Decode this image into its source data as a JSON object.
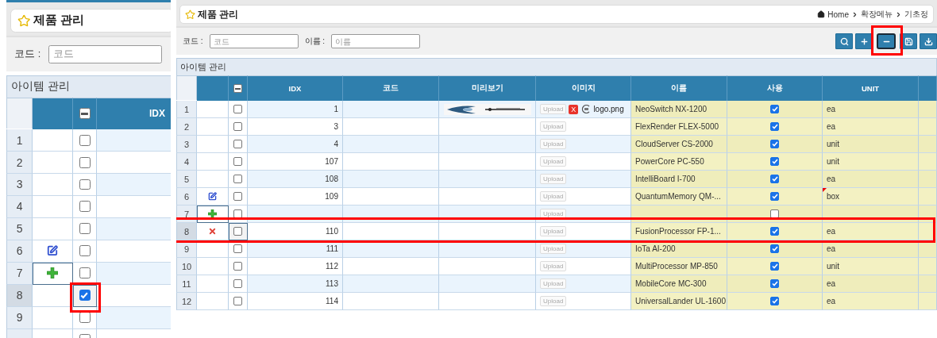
{
  "left_view": {
    "title": "제품 관리",
    "search_fields": [
      {
        "label": "코드 :",
        "placeholder": "코드"
      }
    ],
    "section_title": "아이템 관리",
    "header_partial": true,
    "columns": [
      {
        "kind": "idx",
        "label": "IDX"
      }
    ],
    "rows": [
      {
        "kind": "plain",
        "num": "1",
        "checked": false,
        "status_focused": false,
        "check_focused": false,
        "selected": false,
        "highlighted": false
      },
      {
        "kind": "plain",
        "num": "2",
        "checked": false,
        "status_focused": false,
        "check_focused": false,
        "selected": false,
        "highlighted": false
      },
      {
        "kind": "plain",
        "num": "3",
        "checked": false,
        "status_focused": false,
        "check_focused": false,
        "selected": false,
        "highlighted": false
      },
      {
        "kind": "plain",
        "num": "4",
        "checked": false,
        "status_focused": false,
        "check_focused": false,
        "selected": false,
        "highlighted": false
      },
      {
        "kind": "plain",
        "num": "5",
        "checked": false,
        "status_focused": false,
        "check_focused": false,
        "selected": false,
        "highlighted": false
      },
      {
        "kind": "edit",
        "num": "6",
        "checked": false,
        "status_focused": false,
        "check_focused": false,
        "selected": false,
        "highlighted": false
      },
      {
        "kind": "add",
        "num": "7",
        "checked": false,
        "status_focused": true,
        "check_focused": false,
        "selected": false,
        "highlighted": false
      },
      {
        "kind": "plain",
        "num": "8",
        "checked": true,
        "status_focused": false,
        "check_focused": true,
        "selected": true,
        "highlighted": true
      },
      {
        "kind": "plain",
        "num": "9",
        "checked": false,
        "status_focused": false,
        "check_focused": false,
        "selected": false,
        "highlighted": false
      },
      {
        "kind": "plain",
        "checked": false,
        "status_focused": false,
        "check_focused": false,
        "selected": false,
        "highlighted": false
      }
    ]
  },
  "right_view": {
    "title": "제품 관리",
    "breadcrumb": [
      "Home",
      "확장메뉴",
      "기초정"
    ],
    "search_fields": [
      {
        "label": "코드 :",
        "placeholder": "코드"
      },
      {
        "label": "이름 :",
        "placeholder": "이름"
      }
    ],
    "toolbar": [
      {
        "kind": "search",
        "highlighted": false
      },
      {
        "kind": "add",
        "highlighted": false
      },
      {
        "kind": "remove",
        "highlighted": true
      },
      {
        "kind": "save",
        "highlighted": false
      },
      {
        "kind": "download",
        "highlighted": false
      }
    ],
    "section_title": "아이템 관리",
    "header_partial": true,
    "columns": [
      {
        "kind": "idx",
        "label": "IDX"
      },
      {
        "kind": "code",
        "label": "코드"
      },
      {
        "kind": "preview",
        "label": "미리보기"
      },
      {
        "label": "이미지"
      },
      {
        "kind": "name",
        "label": "이름"
      },
      {
        "kind": "use",
        "label": "사용"
      },
      {
        "kind": "unit",
        "label": "UNIT"
      }
    ],
    "rows": [
      {
        "kind": "plain",
        "num": "1",
        "checked": false,
        "status_focused": false,
        "check_focused": false,
        "selected": false,
        "highlighted": false,
        "idx": "1",
        "has_preview": true,
        "upload": "Upload",
        "remove": "X",
        "file_name": "logo.png",
        "name": "NeoSwitch NX-1200",
        "use": true,
        "unit": "ea",
        "unit_flag": false
      },
      {
        "kind": "plain",
        "num": "2",
        "checked": false,
        "status_focused": false,
        "check_focused": false,
        "selected": false,
        "highlighted": false,
        "idx": "3",
        "has_preview": false,
        "upload": "Upload",
        "name": "FlexRender FLEX-5000",
        "use": true,
        "unit": "ea",
        "unit_flag": false
      },
      {
        "kind": "plain",
        "num": "3",
        "checked": false,
        "status_focused": false,
        "check_focused": false,
        "selected": false,
        "highlighted": false,
        "idx": "4",
        "has_preview": false,
        "upload": "Upload",
        "name": "CloudServer CS-2000",
        "use": true,
        "unit": "unit",
        "unit_flag": false
      },
      {
        "kind": "plain",
        "num": "4",
        "checked": false,
        "status_focused": false,
        "check_focused": false,
        "selected": false,
        "highlighted": false,
        "idx": "107",
        "has_preview": false,
        "upload": "Upload",
        "name": "PowerCore PC-550",
        "use": true,
        "unit": "unit",
        "unit_flag": false
      },
      {
        "kind": "plain",
        "num": "5",
        "checked": false,
        "status_focused": false,
        "check_focused": false,
        "selected": false,
        "highlighted": false,
        "idx": "108",
        "has_preview": false,
        "upload": "Upload",
        "name": "IntelliBoard I-700",
        "use": true,
        "unit": "ea",
        "unit_flag": false
      },
      {
        "kind": "edit",
        "num": "6",
        "checked": false,
        "status_focused": false,
        "check_focused": false,
        "selected": false,
        "highlighted": false,
        "idx": "109",
        "has_preview": false,
        "upload": "Upload",
        "name": "QuantumMemory QM-...",
        "use": true,
        "unit": "box",
        "unit_flag": true
      },
      {
        "kind": "add",
        "num": "7",
        "checked": false,
        "status_focused": true,
        "check_focused": false,
        "selected": false,
        "highlighted": false,
        "has_preview": false,
        "upload": "Upload",
        "use": false,
        "unit_flag": false
      },
      {
        "kind": "delete",
        "num": "8",
        "checked": false,
        "status_focused": false,
        "check_focused": true,
        "selected": true,
        "highlighted": true,
        "idx": "110",
        "has_preview": false,
        "upload": "Upload",
        "name": "FusionProcessor FP-1...",
        "use": true,
        "unit": "ea",
        "unit_flag": false
      },
      {
        "kind": "plain",
        "num": "9",
        "checked": false,
        "status_focused": false,
        "check_focused": false,
        "selected": false,
        "highlighted": false,
        "idx": "111",
        "has_preview": false,
        "upload": "Upload",
        "name": "IoTa AI-200",
        "use": true,
        "unit": "ea",
        "unit_flag": false
      },
      {
        "kind": "plain",
        "num": "10",
        "checked": false,
        "status_focused": false,
        "check_focused": false,
        "selected": false,
        "highlighted": false,
        "idx": "112",
        "has_preview": false,
        "upload": "Upload",
        "name": "MultiProcessor MP-850",
        "use": true,
        "unit": "unit",
        "unit_flag": false
      },
      {
        "kind": "plain",
        "num": "11",
        "checked": false,
        "status_focused": false,
        "check_focused": false,
        "selected": false,
        "highlighted": false,
        "idx": "113",
        "has_preview": false,
        "upload": "Upload",
        "name": "MobileCore MC-300",
        "use": true,
        "unit": "ea",
        "unit_flag": false
      },
      {
        "kind": "plain",
        "num": "12",
        "checked": false,
        "status_focused": false,
        "check_focused": false,
        "selected": false,
        "highlighted": false,
        "idx": "114",
        "has_preview": false,
        "upload": "Upload",
        "name": "UniversalLander UL-1600",
        "use": true,
        "unit": "ea",
        "unit_flag": false
      }
    ]
  }
}
